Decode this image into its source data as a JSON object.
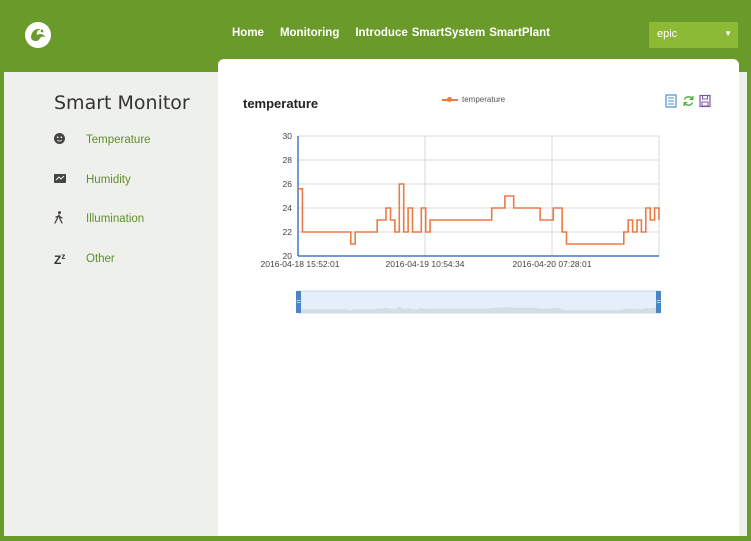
{
  "nav": {
    "links": [
      "Home",
      "Monitoring",
      "Introduce",
      "SmartSystem",
      "SmartPlant"
    ],
    "user": "epic"
  },
  "sidebar": {
    "title": "Smart Monitor",
    "items": [
      {
        "label": "Temperature",
        "icon": "face-icon"
      },
      {
        "label": "Humidity",
        "icon": "monitor-icon"
      },
      {
        "label": "Illumination",
        "icon": "walking-person-icon"
      },
      {
        "label": "Other",
        "icon": "sleep-z-icon"
      }
    ]
  },
  "panel": {
    "title": "temperature",
    "tools": [
      "data-view-icon",
      "refresh-icon",
      "save-icon"
    ]
  },
  "colors": {
    "accent": "#6a9a2a",
    "line": "#ed7a43",
    "link": "#5f8f2a"
  },
  "chart_data": {
    "type": "line",
    "legend": [
      "temperature"
    ],
    "ylim": [
      20,
      30
    ],
    "yticks": [
      20,
      22,
      24,
      26,
      28,
      30
    ],
    "xticks": [
      "2016-04-18 15:52:01",
      "2016-04-19 10:54:34",
      "2016-04-20 07:28:01"
    ],
    "grid": true,
    "series": [
      {
        "name": "temperature",
        "values": [
          25.6,
          22.0,
          22.0,
          22.0,
          22.0,
          22.0,
          22.0,
          22.0,
          22.0,
          22.0,
          22.0,
          22.0,
          21.0,
          22.0,
          22.0,
          22.0,
          22.0,
          22.0,
          23.0,
          23.0,
          24.0,
          23.0,
          22.0,
          26.0,
          22.0,
          24.0,
          22.0,
          22.0,
          24.0,
          22.0,
          23.0,
          23.0,
          23.0,
          23.0,
          23.0,
          23.0,
          23.0,
          23.0,
          23.0,
          23.0,
          23.0,
          23.0,
          23.0,
          23.0,
          24.0,
          24.0,
          24.0,
          25.0,
          25.0,
          24.0,
          24.0,
          24.0,
          24.0,
          24.0,
          24.0,
          23.0,
          23.0,
          23.0,
          24.0,
          24.0,
          22.0,
          21.0,
          21.0,
          21.0,
          21.0,
          21.0,
          21.0,
          21.0,
          21.0,
          21.0,
          21.0,
          21.0,
          21.0,
          21.0,
          22.0,
          23.0,
          22.0,
          23.0,
          22.0,
          24.0,
          23.0,
          24.0,
          23.0
        ]
      }
    ],
    "navigator": {
      "start_label": "=",
      "end_label": "="
    }
  }
}
